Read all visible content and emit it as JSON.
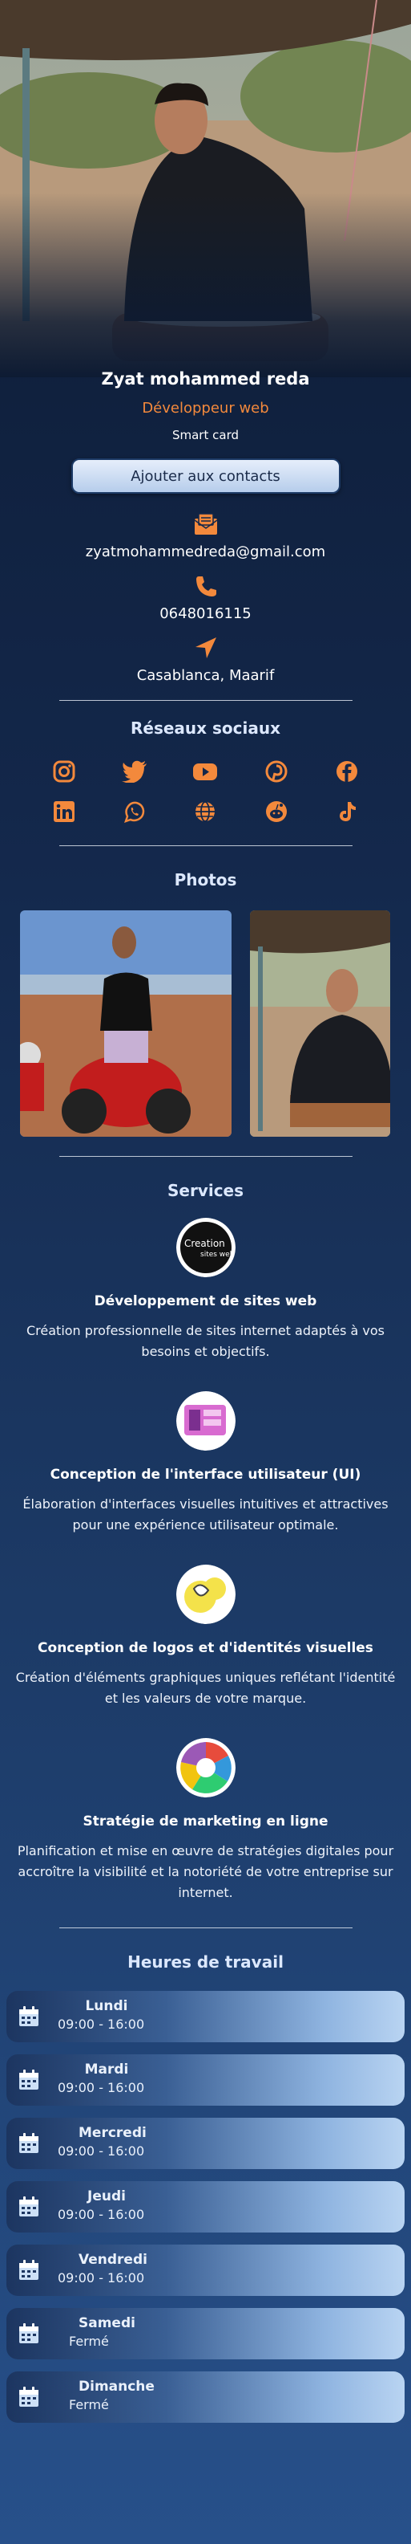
{
  "profile": {
    "name": "Zyat mohammed reda",
    "job_title": "Développeur web",
    "card_label": "Smart card",
    "add_contact_label": "Ajouter aux contacts"
  },
  "contact": {
    "email": "zyatmohammedreda@gmail.com",
    "phone": "0648016115",
    "address": "Casablanca, Maarif"
  },
  "colors": {
    "accent": "#f3893c",
    "background": "#13274a"
  },
  "social": {
    "title": "Réseaux sociaux",
    "icons": [
      "instagram-icon",
      "twitter-icon",
      "youtube-icon",
      "pinterest-icon",
      "facebook-icon",
      "linkedin-icon",
      "whatsapp-icon",
      "globe-icon",
      "reddit-icon",
      "tiktok-icon"
    ]
  },
  "photos": {
    "title": "Photos"
  },
  "services": {
    "title": "Services",
    "items": [
      {
        "title": "Développement de sites web",
        "description": "Création professionnelle de sites internet adaptés à vos besoins et objectifs."
      },
      {
        "title": "Conception de l'interface utilisateur (UI)",
        "description": "Élaboration d'interfaces visuelles intuitives et attractives pour une expérience utilisateur optimale."
      },
      {
        "title": "Conception de logos et d'identités visuelles",
        "description": "Création d'éléments graphiques uniques reflétant l'identité et les valeurs de votre marque."
      },
      {
        "title": "Stratégie de marketing en ligne",
        "description": "Planification et mise en œuvre de stratégies digitales pour accroître la visibilité et la notoriété de votre entreprise sur internet."
      }
    ]
  },
  "hours": {
    "title": "Heures de travail",
    "days": [
      {
        "day": "Lundi",
        "time": "09:00 - 16:00"
      },
      {
        "day": "Mardi",
        "time": "09:00 - 16:00"
      },
      {
        "day": "Mercredi",
        "time": "09:00 - 16:00"
      },
      {
        "day": "Jeudi",
        "time": "09:00 - 16:00"
      },
      {
        "day": "Vendredi",
        "time": "09:00 - 16:00"
      },
      {
        "day": "Samedi",
        "time": "Fermé"
      },
      {
        "day": "Dimanche",
        "time": "Fermé"
      }
    ]
  }
}
